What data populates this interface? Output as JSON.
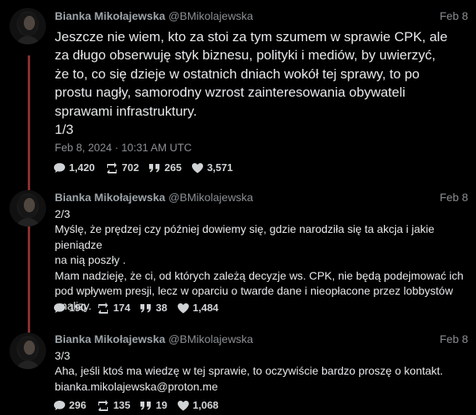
{
  "tweets": [
    {
      "author_name": "Bianka Mikołajewska",
      "handle": "@BMikolajewska",
      "date": "Feb 8",
      "text": "Jeszcze nie wiem, kto za stoi za tym szumem w sprawie CPK, ale\nza długo obserwuję styk biznesu, polityki i mediów, by uwierzyć,\nże to, co się dzieje w ostatnich dniach wokół tej sprawy, to po\nprostu nagły, samorodny wzrost zainteresowania obywateli\nsprawami infrastruktury.\n1/3",
      "timestamp": "Feb 8, 2024 · 10:31 AM UTC",
      "replies": "1,420",
      "retweets": "702",
      "quotes": "265",
      "likes": "3,571"
    },
    {
      "author_name": "Bianka Mikołajewska",
      "handle": "@BMikolajewska",
      "date": "Feb 8",
      "text": "2/3\nMyślę, że prędzej czy później dowiemy się, gdzie narodziła się ta akcja i jakie pieniądze\nna nią poszły .\nMam nadzieję, że ci, od których zależą decyzje ws. CPK, nie będą podejmować ich\npod wpływem presji, lecz w oparciu o twarde dane i nieopłacone przez lobbystów\nanalizy.",
      "replies": "190",
      "retweets": "174",
      "quotes": "38",
      "likes": "1,484"
    },
    {
      "author_name": "Bianka Mikołajewska",
      "handle": "@BMikolajewska",
      "date": "Feb 8",
      "text": "3/3\nAha, jeśli ktoś ma wiedzę w tej sprawie, to oczywiście bardzo proszę o kontakt.\nbianka.mikolajewska@proton.me",
      "replies": "296",
      "retweets": "135",
      "quotes": "19",
      "likes": "1,068"
    }
  ]
}
